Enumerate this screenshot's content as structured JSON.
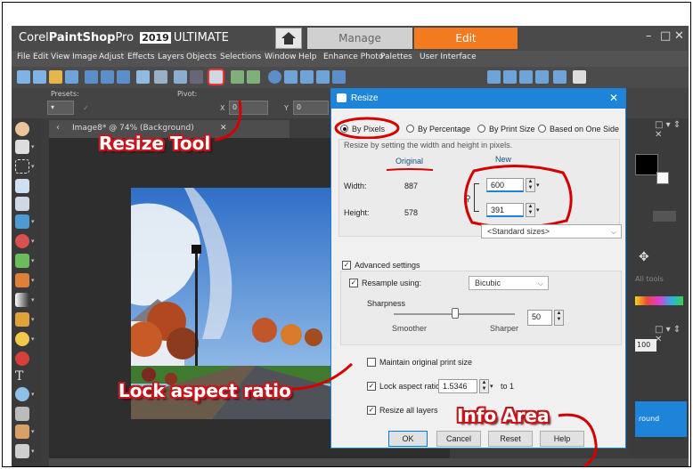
{
  "app": {
    "brand_prefix": "Corel",
    "brand_name": "PaintShop",
    "brand_suffix": "Pro",
    "year": "2019",
    "edition": "ULTIMATE",
    "tabs": [
      "Manage",
      "Edit"
    ],
    "active_tab": "Edit"
  },
  "window_controls": {
    "minimize": "–",
    "maximize": "□",
    "close": "✕"
  },
  "menu": [
    "File",
    "Edit",
    "View",
    "Image",
    "Adjust",
    "Effects",
    "Layers",
    "Objects",
    "Selections",
    "Window",
    "Help",
    "Enhance Photo",
    "Palettes",
    "User Interface"
  ],
  "options_bar": {
    "presets_label": "Presets:",
    "pivot_label": "Pivot:",
    "x_label": "X",
    "x_value": "0",
    "y_label": "Y",
    "y_value": "0"
  },
  "image_tab": {
    "title": "Image8* @ 74% (Background)",
    "close": "✕"
  },
  "right_panel": {
    "alltools_label": "All tools",
    "opacity_value": "100",
    "layer_label": "round"
  },
  "dialog": {
    "title": "Resize",
    "close": "✕",
    "modes": [
      "By Pixels",
      "By Percentage",
      "By Print Size",
      "Based on One Side"
    ],
    "selected_mode": "By Pixels",
    "instruction": "Resize by setting the width and height in pixels.",
    "original_header": "Original",
    "new_header": "New",
    "width_label": "Width:",
    "height_label": "Height:",
    "original_width": "887",
    "original_height": "578",
    "new_width": "600",
    "new_height": "391",
    "standard_sizes": "<Standard sizes>",
    "advanced_settings_label": "Advanced settings",
    "advanced_settings_checked": true,
    "resample_label": "Resample using:",
    "resample_checked": true,
    "resample_value": "Bicubic",
    "sharpness_label": "Sharpness",
    "sharpness_value": "50",
    "smoother_label": "Smoother",
    "sharper_label": "Sharper",
    "maintain_print_label": "Maintain original print size",
    "maintain_print_checked": false,
    "lock_aspect_label": "Lock aspect ratio:",
    "lock_aspect_checked": true,
    "aspect_value": "1.5346",
    "aspect_suffix": "to 1",
    "resize_layers_label": "Resize all layers",
    "resize_layers_checked": true,
    "buttons": {
      "ok": "OK",
      "cancel": "Cancel",
      "reset": "Reset",
      "help": "Help"
    }
  },
  "annotations": {
    "resize_tool": "Resize Tool",
    "lock_aspect": "Lock aspect ratio",
    "info_area": "Info Area"
  },
  "colors": {
    "accent": "#f37a1f",
    "dialog_title": "#1e84d9",
    "annotation_red": "#c4161c",
    "app_bg": "#3c3c3c"
  }
}
